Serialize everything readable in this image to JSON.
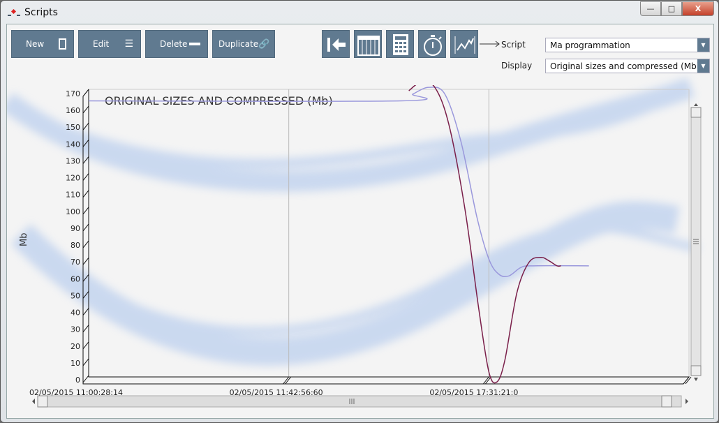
{
  "window": {
    "title": "Scripts",
    "minimize": "—",
    "maximize": "□",
    "close": "X"
  },
  "toolbar": {
    "buttons": [
      {
        "label": "New",
        "icon": "square-icon"
      },
      {
        "label": "Edit",
        "icon": "list-icon"
      },
      {
        "label": "Delete",
        "icon": "minus-icon"
      },
      {
        "label": "Duplicate",
        "icon": "link-icon"
      }
    ],
    "icon_buttons": [
      "back-to-start-icon",
      "calendar-icon",
      "calculator-icon",
      "stopwatch-icon",
      "chart-icon"
    ]
  },
  "script": {
    "label": "Script",
    "value": "Ma programmation"
  },
  "display": {
    "label": "Display",
    "value": "Original sizes and compressed (Mb)"
  },
  "chart_data": {
    "type": "line",
    "title": "ORIGINAL SIZES AND COMPRESSED (Mb)",
    "ylabel": "Mb",
    "xlabel": "",
    "ylim": [
      0,
      170
    ],
    "yticks": [
      0,
      10,
      20,
      30,
      40,
      50,
      60,
      70,
      80,
      90,
      100,
      110,
      120,
      130,
      140,
      150,
      160,
      170
    ],
    "x_tick_labels": [
      "02/05/2015 11:00:28:14",
      "02/05/2015 11:42:56:60",
      "02/05/2015 17:31:21:0"
    ],
    "grid": "vertical",
    "series": [
      {
        "color": "#9a98dc",
        "points": [
          [
            0,
            164
          ],
          [
            1.56,
            164
          ],
          [
            1.62,
            168
          ],
          [
            1.7,
            172
          ],
          [
            1.78,
            168
          ],
          [
            1.86,
            140
          ],
          [
            1.94,
            95
          ],
          [
            2.0,
            70
          ],
          [
            2.05,
            61
          ],
          [
            2.1,
            60
          ],
          [
            2.16,
            65
          ],
          [
            2.22,
            66
          ],
          [
            2.5,
            66
          ]
        ]
      },
      {
        "color": "#7a1f4a",
        "points": [
          [
            1.6,
            170
          ],
          [
            1.66,
            175
          ],
          [
            1.73,
            172
          ],
          [
            1.8,
            150
          ],
          [
            1.88,
            100
          ],
          [
            1.95,
            40
          ],
          [
            2.0,
            3
          ],
          [
            2.04,
            -3
          ],
          [
            2.08,
            10
          ],
          [
            2.14,
            50
          ],
          [
            2.2,
            68
          ],
          [
            2.26,
            71
          ],
          [
            2.3,
            69
          ],
          [
            2.34,
            66
          ],
          [
            2.36,
            66
          ]
        ]
      }
    ]
  }
}
